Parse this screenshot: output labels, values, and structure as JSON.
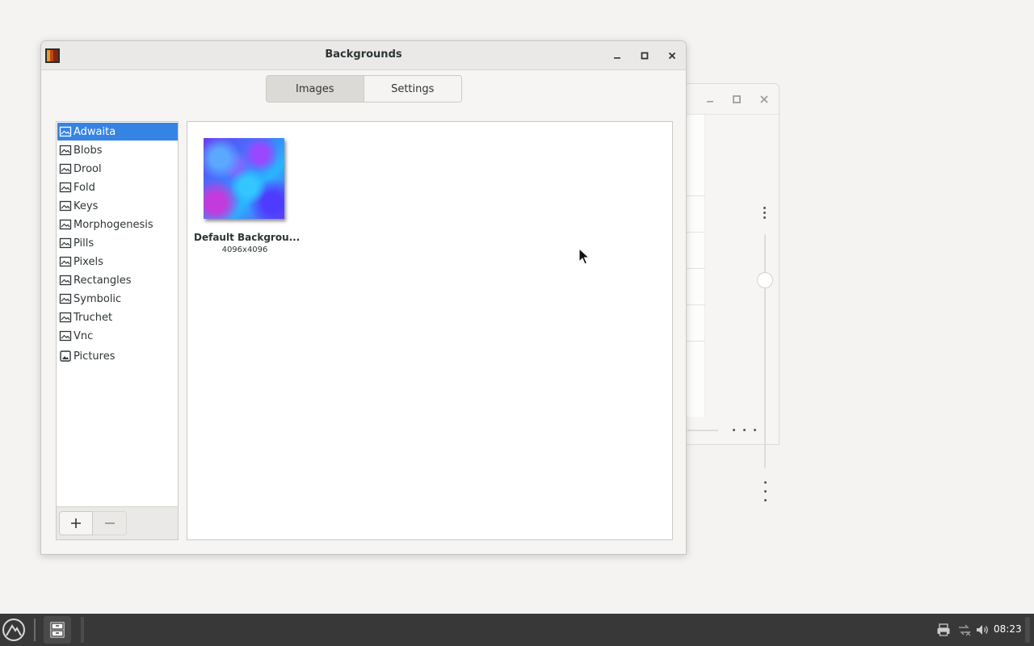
{
  "window": {
    "title": "Backgrounds"
  },
  "tabs": [
    {
      "label": "Images",
      "active": true
    },
    {
      "label": "Settings",
      "active": false
    }
  ],
  "sources": [
    {
      "label": "Adwaita",
      "icon": "image-folder-icon",
      "selected": true
    },
    {
      "label": "Blobs",
      "icon": "image-folder-icon"
    },
    {
      "label": "Drool",
      "icon": "image-folder-icon"
    },
    {
      "label": "Fold",
      "icon": "image-folder-icon"
    },
    {
      "label": "Keys",
      "icon": "image-folder-icon"
    },
    {
      "label": "Morphogenesis",
      "icon": "image-folder-icon"
    },
    {
      "label": "Pills",
      "icon": "image-folder-icon"
    },
    {
      "label": "Pixels",
      "icon": "image-folder-icon"
    },
    {
      "label": "Rectangles",
      "icon": "image-folder-icon"
    },
    {
      "label": "Symbolic",
      "icon": "image-folder-icon"
    },
    {
      "label": "Truchet",
      "icon": "image-folder-icon"
    },
    {
      "label": "Vnc",
      "icon": "image-folder-icon"
    },
    {
      "label": "Pictures",
      "icon": "pictures-folder-icon"
    }
  ],
  "list_toolbar": {
    "add_icon": "plus-icon",
    "remove_icon": "minus-icon"
  },
  "images": [
    {
      "name": "Default Backgrou...",
      "size": "4096x4096"
    }
  ],
  "taskbar": {
    "clock": "08:23",
    "tray_icons": [
      "printer-icon",
      "network-icon",
      "volume-icon"
    ]
  },
  "colors": {
    "accent": "#3584e4",
    "taskbar": "#383838",
    "desktop": "#f4f3f1"
  }
}
